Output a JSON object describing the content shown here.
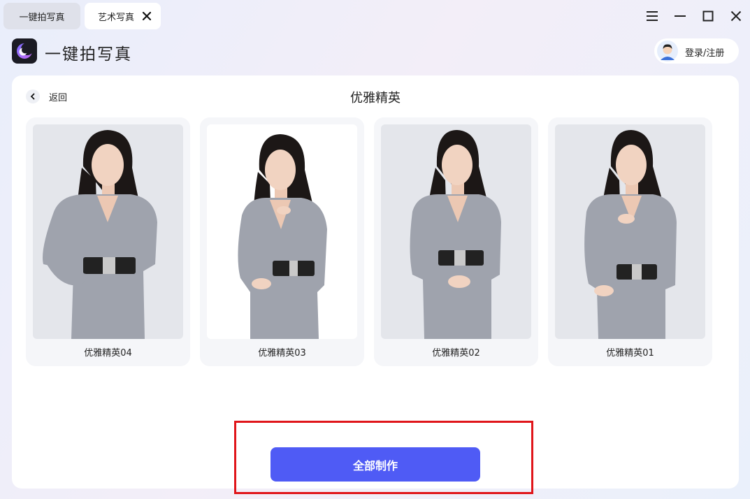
{
  "tabs": [
    {
      "label": "一键拍写真"
    },
    {
      "label": "艺术写真"
    }
  ],
  "header": {
    "app_title": "一键拍写真",
    "login_label": "登录/注册"
  },
  "panel": {
    "back_label": "返回",
    "title": "优雅精英",
    "cards": [
      {
        "label": "优雅精英04"
      },
      {
        "label": "优雅精英03"
      },
      {
        "label": "优雅精英02"
      },
      {
        "label": "优雅精英01"
      }
    ],
    "make_all_label": "全部制作"
  },
  "colors": {
    "accent": "#4f5bf5",
    "highlight": "#e0151a",
    "suit": "#9fa3ad",
    "hair": "#1c1716"
  }
}
